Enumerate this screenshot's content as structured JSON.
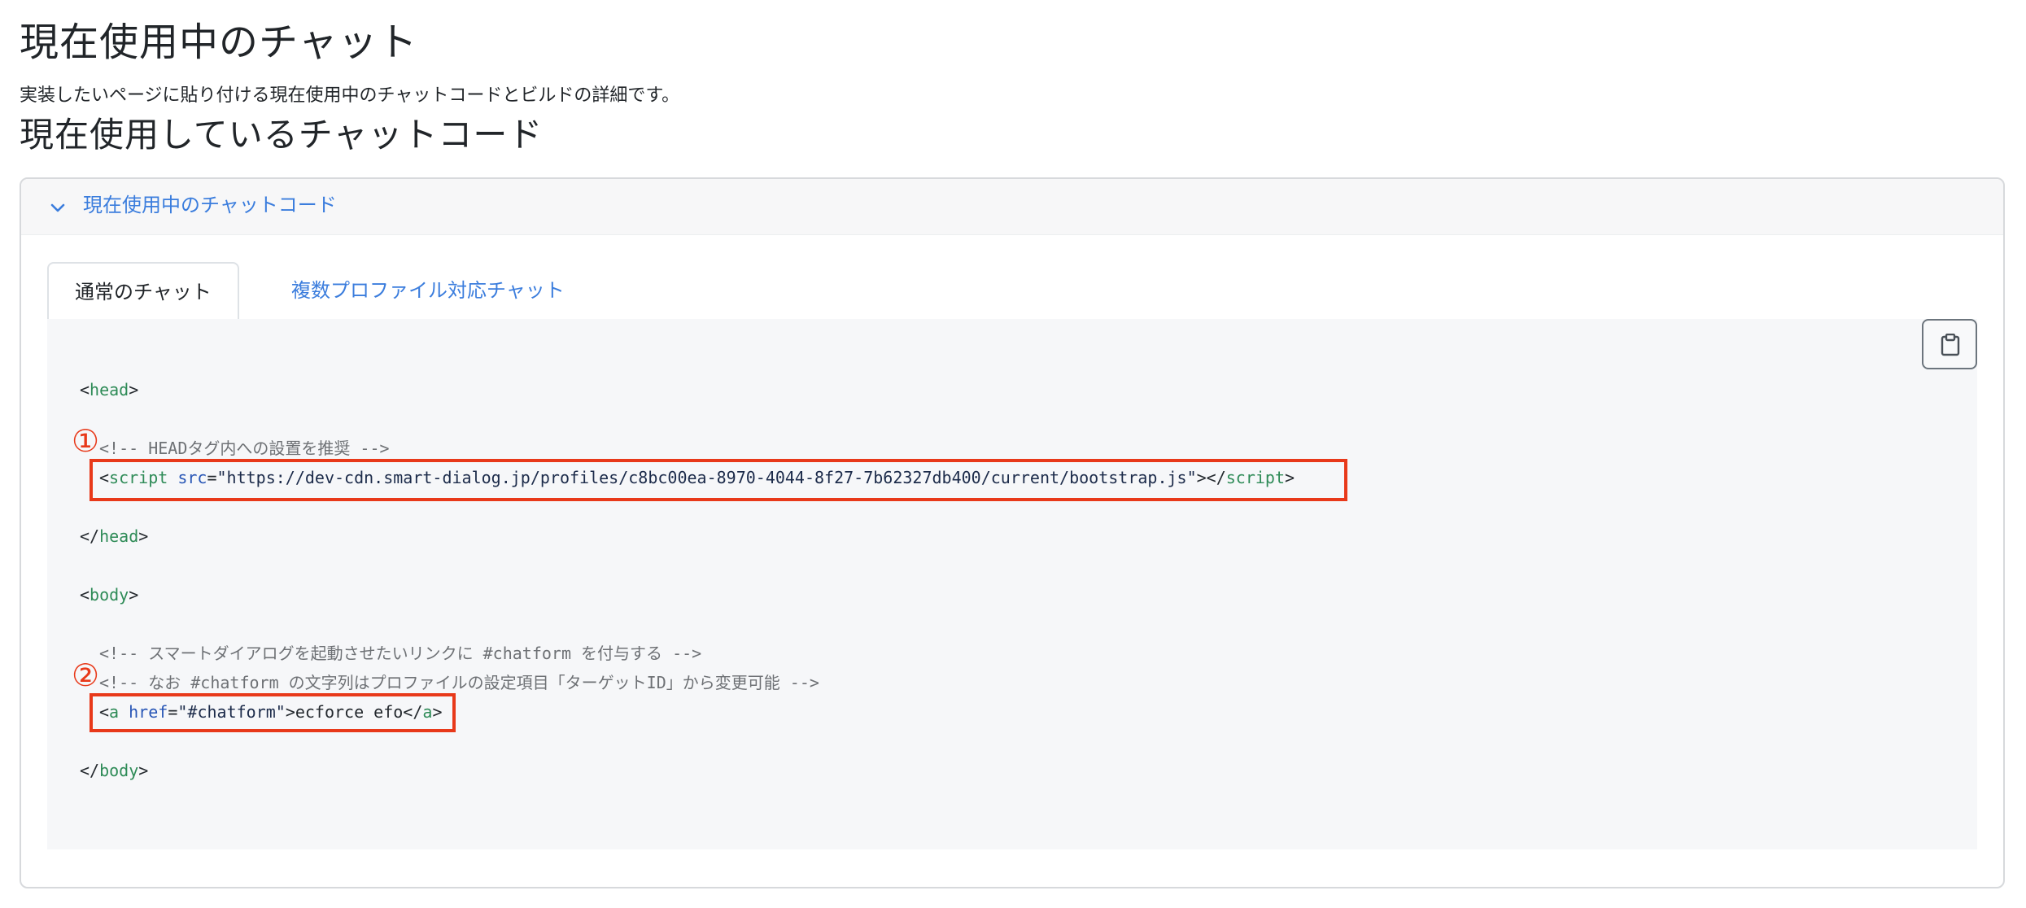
{
  "page": {
    "title": "現在使用中のチャット",
    "description": "実装したいページに貼り付ける現在使用中のチャットコードとビルドの詳細です。",
    "section_title": "現在使用しているチャットコード"
  },
  "accordion": {
    "label": "現在使用中のチャットコード",
    "icon": "chevron-down-icon",
    "expanded": true
  },
  "tabs": [
    {
      "label": "通常のチャット",
      "active": true
    },
    {
      "label": "複数プロファイル対応チャット",
      "active": false
    }
  ],
  "copy_button": {
    "icon": "clipboard-icon"
  },
  "code": {
    "head_open": {
      "lt": "<",
      "name": "head",
      "gt": ">"
    },
    "comment_head": "<!-- HEADタグ内への設置を推奨 -->",
    "script_line": {
      "lt": "<",
      "tag": "script",
      "attr": "src",
      "eq": "=",
      "value": "\"https://dev-cdn.smart-dialog.jp/profiles/c8bc00ea-8970-4044-8f27-7b62327db400/current/bootstrap.js\"",
      "close_mid": "></",
      "tag_close": "script",
      "gt": ">"
    },
    "head_close": {
      "lt": "</",
      "name": "head",
      "gt": ">"
    },
    "body_open": {
      "lt": "<",
      "name": "body",
      "gt": ">"
    },
    "comment_body_1": "<!-- スマートダイアログを起動させたいリンクに #chatform を付与する -->",
    "comment_body_2": "<!-- なお #chatform の文字列はプロファイルの設定項目「ターゲットID」から変更可能 -->",
    "anchor_line": {
      "lt": "<",
      "tag": "a",
      "attr": "href",
      "eq": "=",
      "value": "\"#chatform\"",
      "gt_text": ">ecforce efo</",
      "tag_close": "a",
      "gt": ">"
    },
    "body_close": {
      "lt": "</",
      "name": "body",
      "gt": ">"
    }
  },
  "annotations": {
    "mark_1": "①",
    "mark_2": "②",
    "color": "#e8391a"
  },
  "colors": {
    "link": "#3b7ddd",
    "tag": "#2e8b57",
    "attr": "#2856b6",
    "comment": "#6e7175"
  }
}
